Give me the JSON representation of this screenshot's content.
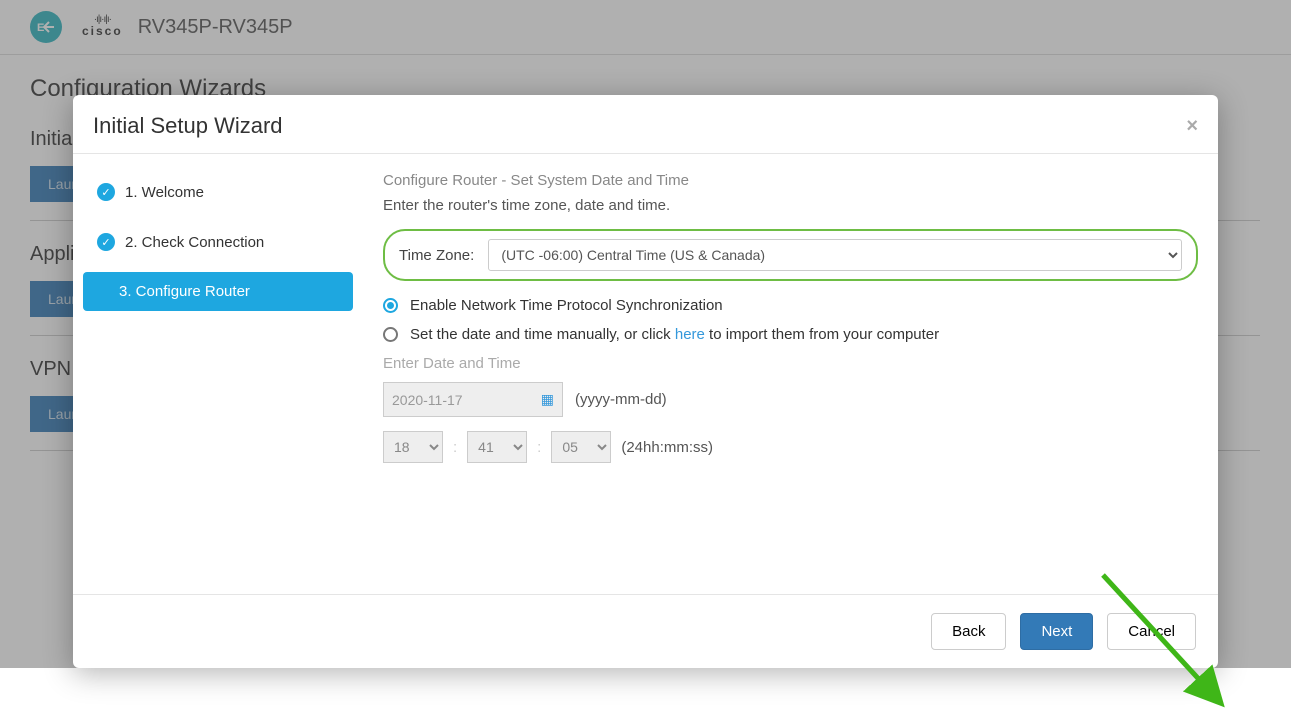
{
  "header": {
    "logo_letters": "E←",
    "cisco_text": "cisco",
    "device_name": "RV345P-RV345P"
  },
  "page": {
    "title": "Configuration Wizards",
    "sections": [
      {
        "title": "Initial Setup Wizard",
        "button": "Launch Wizard"
      },
      {
        "title": "Application Control Wizard",
        "button": "Launch Wizard"
      },
      {
        "title": "VPN Setup Wizard",
        "button": "Launch Wizard"
      }
    ]
  },
  "modal": {
    "title": "Initial Setup Wizard",
    "close": "×",
    "steps": {
      "s1": "1. Welcome",
      "s2": "2. Check Connection",
      "s3": "3. Configure Router"
    },
    "content": {
      "heading": "Configure Router - Set System Date and Time",
      "sub": "Enter the router's time zone, date and time.",
      "tz_label": "Time Zone:",
      "tz_value": "(UTC -06:00) Central Time (US & Canada)",
      "radio1": "Enable Network Time Protocol Synchronization",
      "radio2_pre": "Set the date and time manually, or click ",
      "radio2_link": "here",
      "radio2_post": " to import them from your computer",
      "dt_label": "Enter Date and Time",
      "date_value": "2020-11-17",
      "date_hint": "(yyyy-mm-dd)",
      "hh": "18",
      "mm": "41",
      "ss": "05",
      "time_hint": "(24hh:mm:ss)"
    },
    "footer": {
      "back": "Back",
      "next": "Next",
      "cancel": "Cancel"
    }
  }
}
